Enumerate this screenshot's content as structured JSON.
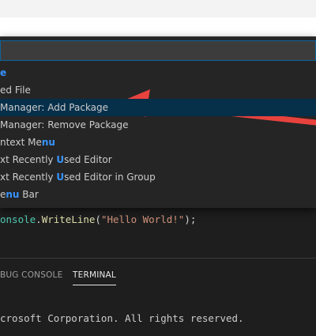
{
  "command_palette": {
    "items": [
      {
        "parts": [
          {
            "t": "",
            "h": false
          },
          {
            "t": "e",
            "h": true
          }
        ]
      },
      {
        "parts": [
          {
            "t": "ed File",
            "h": false
          }
        ]
      },
      {
        "parts": [
          {
            "t": " Manager: Add Package",
            "h": false
          }
        ],
        "selected": true
      },
      {
        "parts": [
          {
            "t": " Manager: Remove Package",
            "h": false
          }
        ]
      },
      {
        "parts": [
          {
            "t": "ntext Me",
            "h": false
          },
          {
            "t": "nu",
            "h": true
          }
        ]
      },
      {
        "parts": [
          {
            "t": "xt Recently ",
            "h": false
          },
          {
            "t": "U",
            "h": true
          },
          {
            "t": "sed Editor",
            "h": false
          }
        ]
      },
      {
        "parts": [
          {
            "t": "xt Recently ",
            "h": false
          },
          {
            "t": "U",
            "h": true
          },
          {
            "t": "sed Editor in Group",
            "h": false
          }
        ]
      },
      {
        "parts": [
          {
            "t": "e",
            "h": false
          },
          {
            "t": "nu",
            "h": true
          },
          {
            "t": " Bar",
            "h": false
          }
        ]
      }
    ]
  },
  "editor": {
    "code_ident": "onsole",
    "code_dot": ".",
    "code_method": "WriteLine",
    "code_open": "(",
    "code_string": "\"Hello World!\"",
    "code_close": ");"
  },
  "panel": {
    "tabs": [
      {
        "label": "BUG CONSOLE"
      },
      {
        "label": "TERMINAL",
        "active": true
      }
    ],
    "terminal_text": "crosoft Corporation. All rights reserved."
  },
  "annotation": {
    "arrow_color": "#e8423d"
  }
}
